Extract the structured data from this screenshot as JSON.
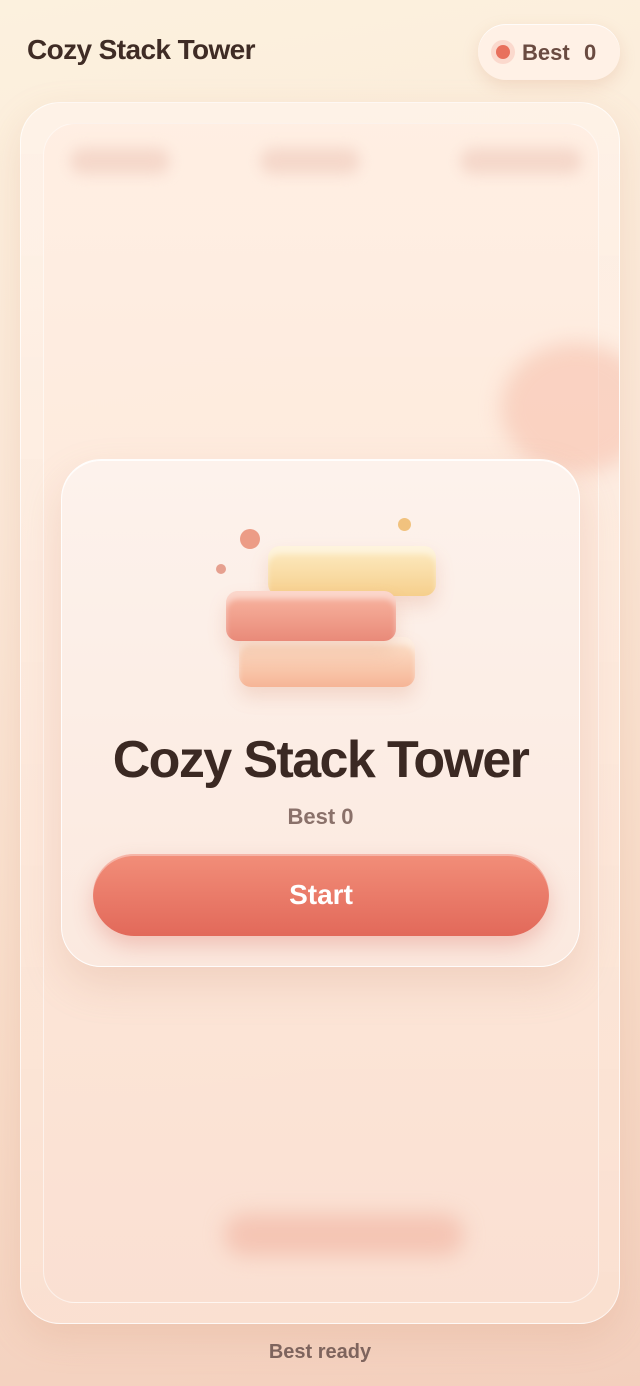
{
  "header": {
    "title": "Cozy Stack Tower",
    "best_label": "Best",
    "best_value": "0"
  },
  "dialog": {
    "title": "Cozy Stack Tower",
    "best_text": "Best 0",
    "start_label": "Start",
    "icon": "stack-tower-icon"
  },
  "footer": {
    "status": "Best ready"
  },
  "colors": {
    "accent": "#e8705c",
    "title_text": "#3f2c25",
    "brick_yellow": "#f6cf8c",
    "brick_coral": "#e98a79",
    "brick_peach": "#f6b596"
  }
}
